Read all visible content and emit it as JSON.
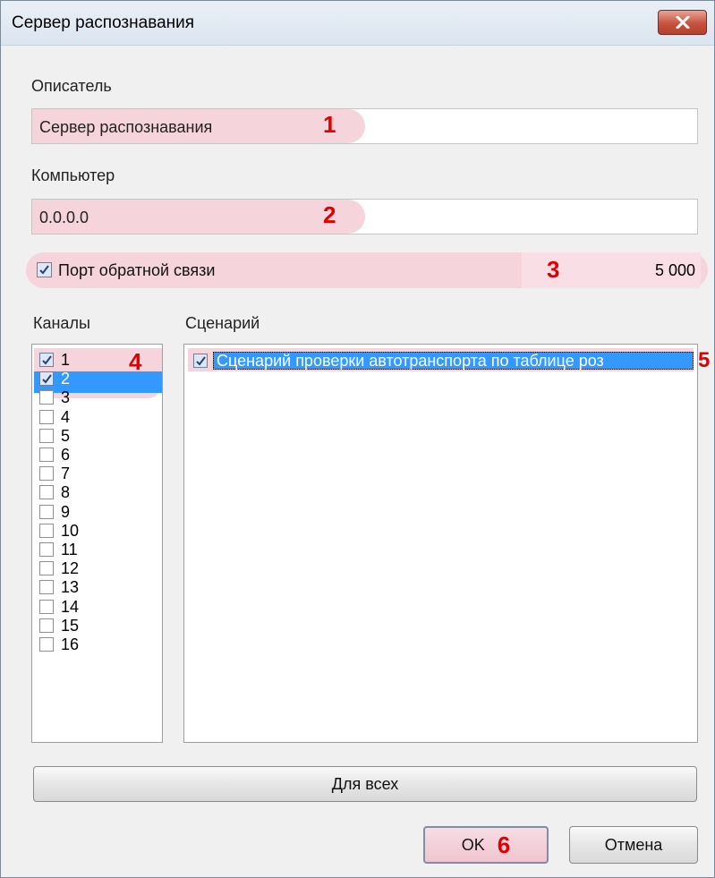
{
  "window": {
    "title": "Сервер распознавания"
  },
  "descriptor": {
    "label": "Описатель",
    "value": "Сервер распознавания",
    "marker": "1"
  },
  "computer": {
    "label": "Компьютер",
    "value": "0.0.0.0",
    "marker": "2"
  },
  "feedback_port": {
    "label": "Порт обратной связи",
    "checked": true,
    "value": "5 000",
    "marker": "3"
  },
  "channels": {
    "label": "Каналы",
    "marker": "4",
    "items": [
      {
        "label": "1",
        "checked": true
      },
      {
        "label": "2",
        "checked": true,
        "selected": true
      },
      {
        "label": "3",
        "checked": false
      },
      {
        "label": "4",
        "checked": false
      },
      {
        "label": "5",
        "checked": false
      },
      {
        "label": "6",
        "checked": false
      },
      {
        "label": "7",
        "checked": false
      },
      {
        "label": "8",
        "checked": false
      },
      {
        "label": "9",
        "checked": false
      },
      {
        "label": "10",
        "checked": false
      },
      {
        "label": "11",
        "checked": false
      },
      {
        "label": "12",
        "checked": false
      },
      {
        "label": "13",
        "checked": false
      },
      {
        "label": "14",
        "checked": false
      },
      {
        "label": "15",
        "checked": false
      },
      {
        "label": "16",
        "checked": false
      }
    ]
  },
  "scenario": {
    "label": "Сценарий",
    "marker": "5",
    "items": [
      {
        "label": "Сценарий проверки автотранспорта по таблице роз",
        "checked": true,
        "selected": true
      }
    ]
  },
  "buttons": {
    "for_all": "Для всех",
    "ok": "OK",
    "ok_marker": "6",
    "cancel": "Отмена"
  },
  "colors": {
    "highlight": "#f6d4dc",
    "selection": "#3399ff",
    "marker": "#e00000"
  }
}
